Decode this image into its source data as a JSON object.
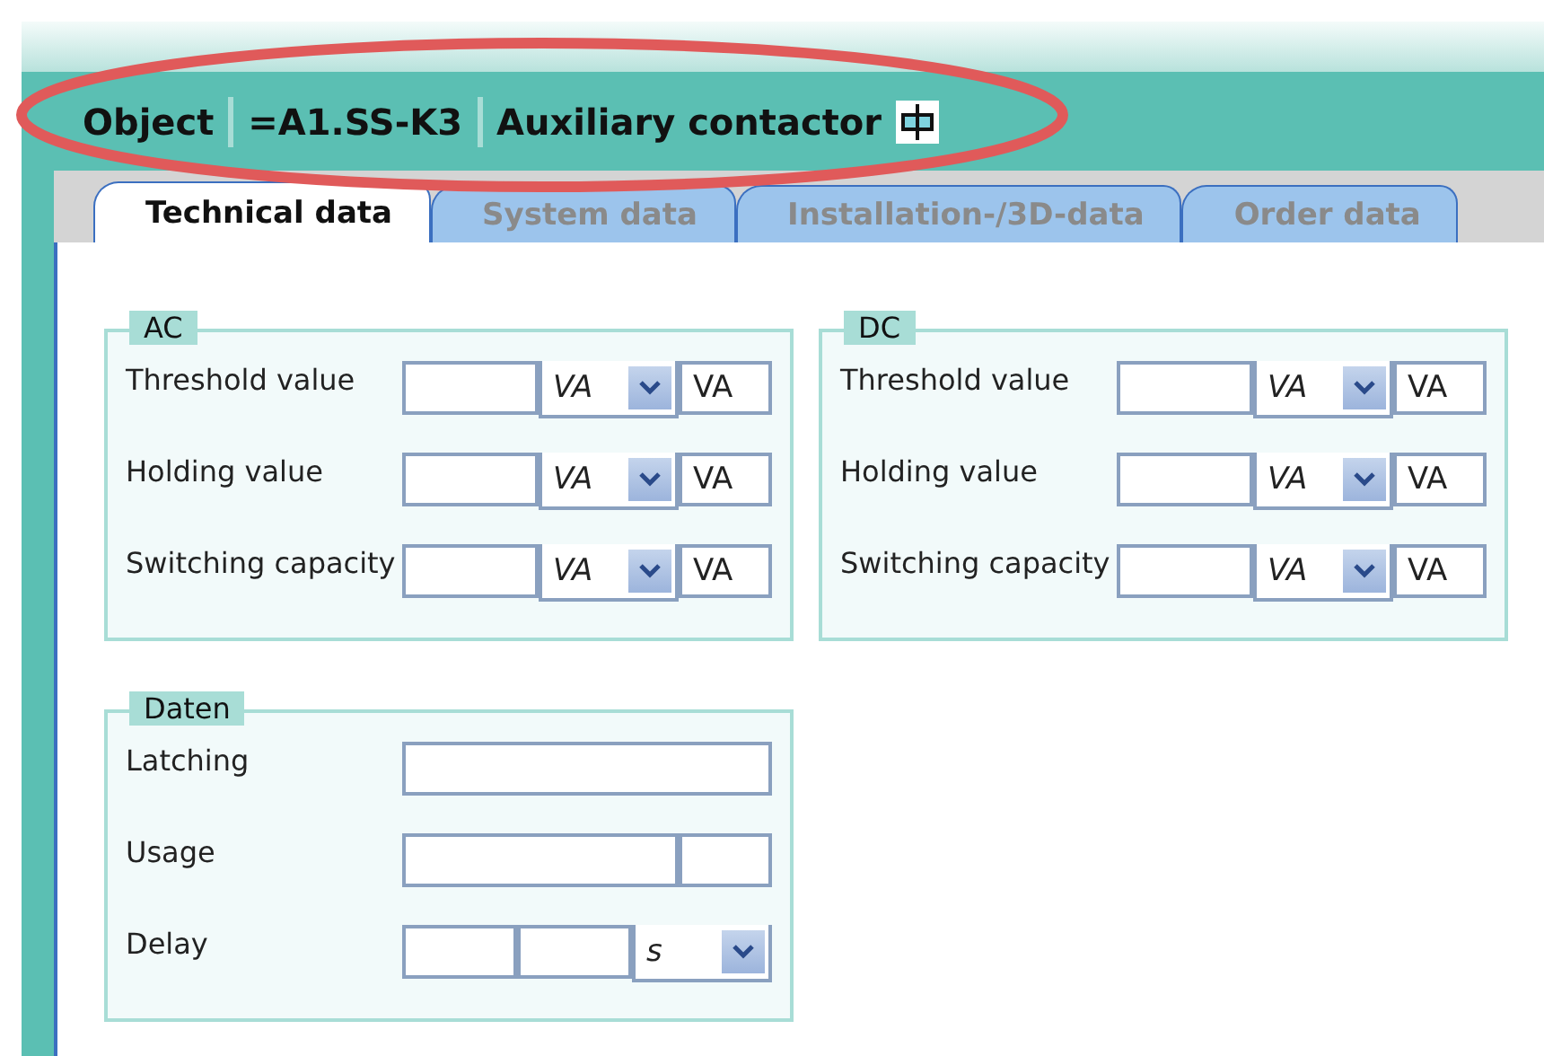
{
  "header": {
    "items": [
      "Object",
      "=A1.SS-K3",
      "Auxiliary contactor"
    ]
  },
  "tabs": [
    {
      "label": "Technical data",
      "selected": true
    },
    {
      "label": "System data",
      "selected": false
    },
    {
      "label": "Installation-/3D-data",
      "selected": false
    },
    {
      "label": "Order data",
      "selected": false
    }
  ],
  "groups": [
    {
      "title": "AC",
      "rows": [
        {
          "label": "Threshold value",
          "fields": [
            {
              "kind": "input"
            },
            {
              "kind": "select",
              "value": "VA"
            },
            {
              "kind": "short",
              "value": "VA"
            }
          ]
        },
        {
          "label": "Holding value",
          "fields": [
            {
              "kind": "input"
            },
            {
              "kind": "select",
              "value": "VA"
            },
            {
              "kind": "short",
              "value": "VA"
            }
          ]
        },
        {
          "label": "Switching capacity",
          "fields": [
            {
              "kind": "input"
            },
            {
              "kind": "select",
              "value": "VA"
            },
            {
              "kind": "short",
              "value": "VA"
            }
          ]
        }
      ]
    },
    {
      "title": "DC",
      "rows": [
        {
          "label": "Threshold value",
          "fields": [
            {
              "kind": "input"
            },
            {
              "kind": "select",
              "value": "VA"
            },
            {
              "kind": "short",
              "value": "VA"
            }
          ]
        },
        {
          "label": "Holding value",
          "fields": [
            {
              "kind": "input"
            },
            {
              "kind": "select",
              "value": "VA"
            },
            {
              "kind": "short",
              "value": "VA"
            }
          ]
        },
        {
          "label": "Switching capacity",
          "fields": [
            {
              "kind": "input"
            },
            {
              "kind": "select",
              "value": "VA"
            },
            {
              "kind": "short",
              "value": "VA"
            }
          ]
        }
      ]
    },
    {
      "title": "Daten",
      "rows": [
        {
          "label": "Latching",
          "fields": [
            {
              "kind": "input"
            }
          ]
        },
        {
          "label": "Usage",
          "fields": [
            {
              "kind": "input"
            },
            {
              "kind": "short"
            }
          ]
        },
        {
          "label": "Delay",
          "fields": [
            {
              "kind": "input"
            },
            {
              "kind": "input"
            },
            {
              "kind": "select",
              "value": "s"
            }
          ]
        }
      ]
    }
  ]
}
